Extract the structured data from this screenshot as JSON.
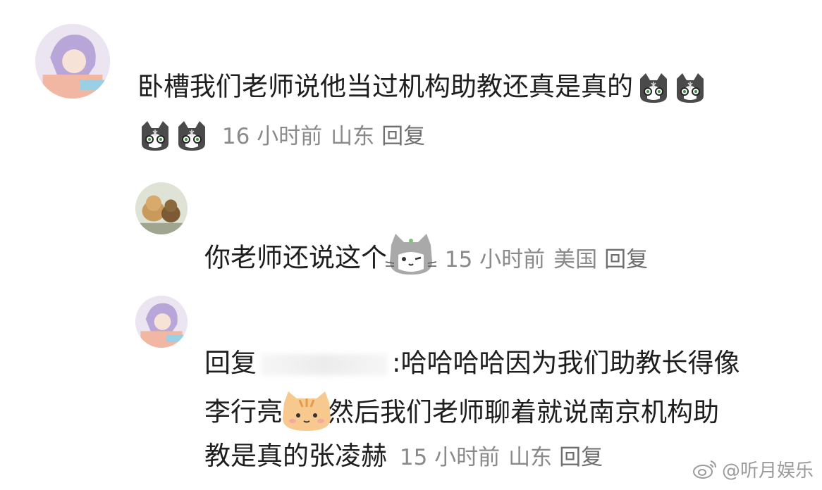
{
  "comments": [
    {
      "username": "",
      "line1": "卧槽我们老师说他当过机构助教还真是真的",
      "time": "16 小时前",
      "location": "山东",
      "reply_label": "回复"
    },
    {
      "username": "",
      "text": "你老师还说这个",
      "time": "15 小时前",
      "location": "美国",
      "reply_label": "回复"
    },
    {
      "username": "",
      "line1_prefix": "回复",
      "line1_suffix": ":哈哈哈哈因为我们助教长得像",
      "line2_prefix": "李行亮",
      "line2_suffix": "然后我们老师聊着就说南京机构助",
      "line3": "教是真的张凌赫",
      "time": "15 小时前",
      "location": "山东",
      "reply_label": "回复"
    }
  ],
  "emoji_names": [
    "cat-dizzy-emoji",
    "cat-wink-emoji",
    "cat-orange-emoji"
  ],
  "watermark": "@听月娱乐"
}
